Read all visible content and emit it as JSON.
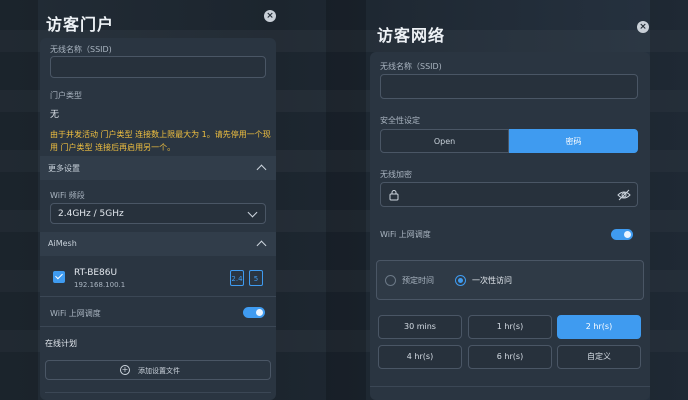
{
  "left_panel": {
    "title": "访客门户",
    "close": "×",
    "ssid_label": "无线名称（SSID)",
    "ssid_value": "",
    "portal_type_label": "门户类型",
    "portal_type_value": "无",
    "warning": "由于并发活动 门户类型 连接数上限最大为 1。请先停用一个现用 门户类型 连接后再启用另一个。",
    "more_settings": "更多设置",
    "wifi_band_label": "WiFi 频段",
    "wifi_band_value": "2.4GHz / 5GHz",
    "aimesh": "AiMesh",
    "node_name": "RT-BE86U",
    "node_ip": "192.168.100.1",
    "band_icon_1": "2.4",
    "band_icon_2": "5",
    "wifi_schedule_label": "WiFi 上网调度",
    "online_plan": "在线计划",
    "add_profile": "添加设置文件"
  },
  "right_panel": {
    "title": "访客网络",
    "close": "×",
    "ssid_label": "无线名称（SSID)",
    "ssid_value": "",
    "security_label": "安全性设定",
    "security_options": [
      "Open",
      "密码"
    ],
    "security_selected": "密码",
    "encryption_label": "无线加密",
    "wifi_schedule_label": "WiFi 上网调度",
    "schedule_options": [
      "预定时间",
      "一次性访问"
    ],
    "schedule_selected": "一次性访问",
    "durations": [
      "30 mins",
      "1 hr(s)",
      "2 hr(s)",
      "4 hr(s)",
      "6 hr(s)",
      "自定义"
    ],
    "duration_selected": "2 hr(s)"
  },
  "colors": {
    "accent": "#3f9bf0",
    "warning": "#f0c040",
    "card": "#2a3541"
  }
}
